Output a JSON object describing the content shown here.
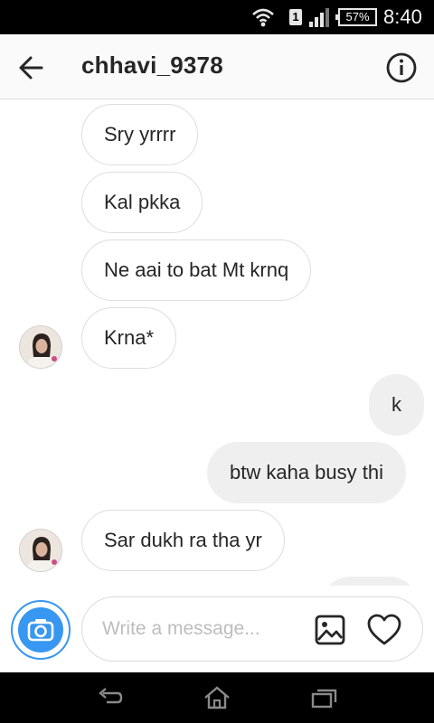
{
  "status_bar": {
    "sim_label": "1",
    "battery": "57%",
    "time": "8:40"
  },
  "header": {
    "username": "chhavi_9378"
  },
  "messages": [
    {
      "direction": "incoming",
      "text": "Sry yrrrr",
      "avatar": false
    },
    {
      "direction": "incoming",
      "text": "Kal pkka",
      "avatar": false
    },
    {
      "direction": "incoming",
      "text": "Ne aai to bat Mt krnq",
      "avatar": false
    },
    {
      "direction": "incoming",
      "text": "Krna*",
      "avatar": true
    },
    {
      "direction": "outgoing",
      "text": "k"
    },
    {
      "direction": "outgoing",
      "text": "btw kaha busy thi"
    },
    {
      "direction": "incoming",
      "text": "Sar dukh ra tha yr",
      "avatar": true
    }
  ],
  "composer": {
    "placeholder": "Write a message..."
  },
  "icons": {
    "back": "arrow-left-icon",
    "info": "info-icon",
    "camera": "camera-icon",
    "gallery": "image-icon",
    "heart": "heart-icon"
  },
  "colors": {
    "accent": "#3897f0",
    "outgoing_bubble": "#efefef",
    "incoming_border": "#dddddd"
  }
}
